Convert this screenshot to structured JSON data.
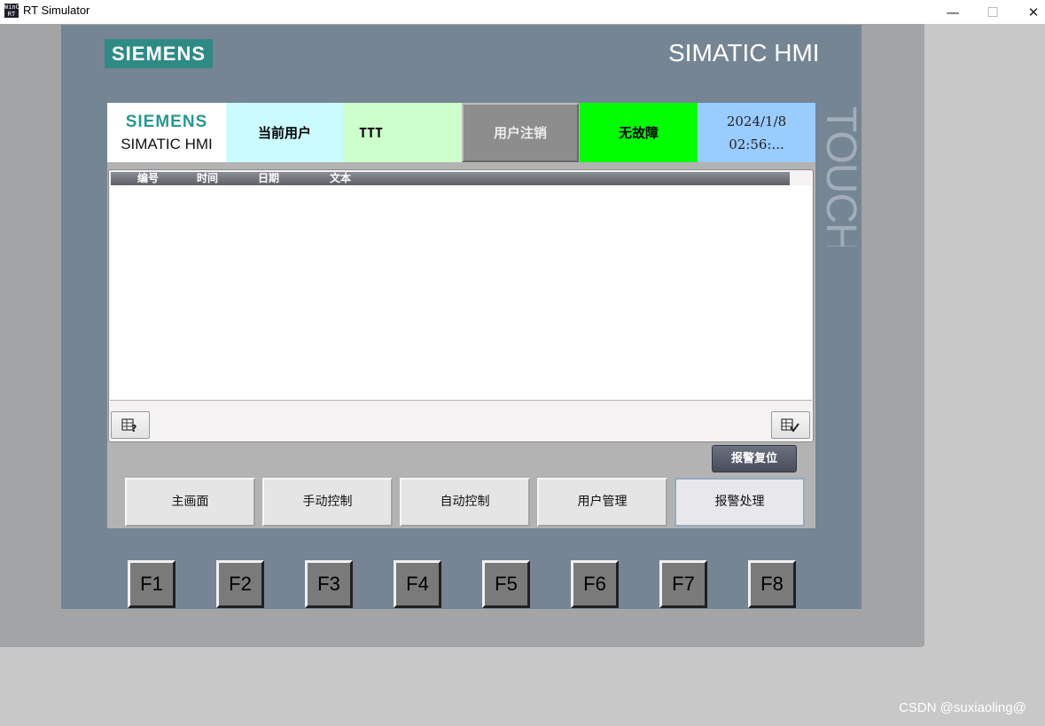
{
  "window": {
    "title": "RT Simulator",
    "icon_text": "WinCC RT",
    "controls": [
      "—",
      "☐",
      "✕"
    ]
  },
  "device": {
    "brand": "SIEMENS",
    "model_title": "SIMATIC HMI",
    "side_label": "TOUCH"
  },
  "header": {
    "logo_brand": "SIEMENS",
    "logo_sub": "SIMATIC HMI",
    "current_user_label": "当前用户",
    "current_user_value": "TTT",
    "logout_button": "用户注销",
    "fault_status": "无故障",
    "date": "2024/1/8",
    "time": "02:56:...",
    "colors": {
      "user_label_bg": "#cbfbff",
      "user_value_bg": "#ccffcc",
      "fault_bg": "#00ff00",
      "datetime_bg": "#99ccff"
    }
  },
  "alarm_view": {
    "columns": [
      "编号",
      "时间",
      "日期",
      "文本"
    ],
    "rows": [],
    "tools": [
      "info-icon",
      "acknowledge-icon"
    ]
  },
  "alarm_reset_button": "报警复位",
  "nav": [
    "主画面",
    "手动控制",
    "自动控制",
    "用户管理",
    "报警处理"
  ],
  "nav_active": "报警处理",
  "function_keys": [
    "F1",
    "F2",
    "F3",
    "F4",
    "F5",
    "F6",
    "F7",
    "F8"
  ],
  "watermark": "CSDN @suxiaoling@"
}
